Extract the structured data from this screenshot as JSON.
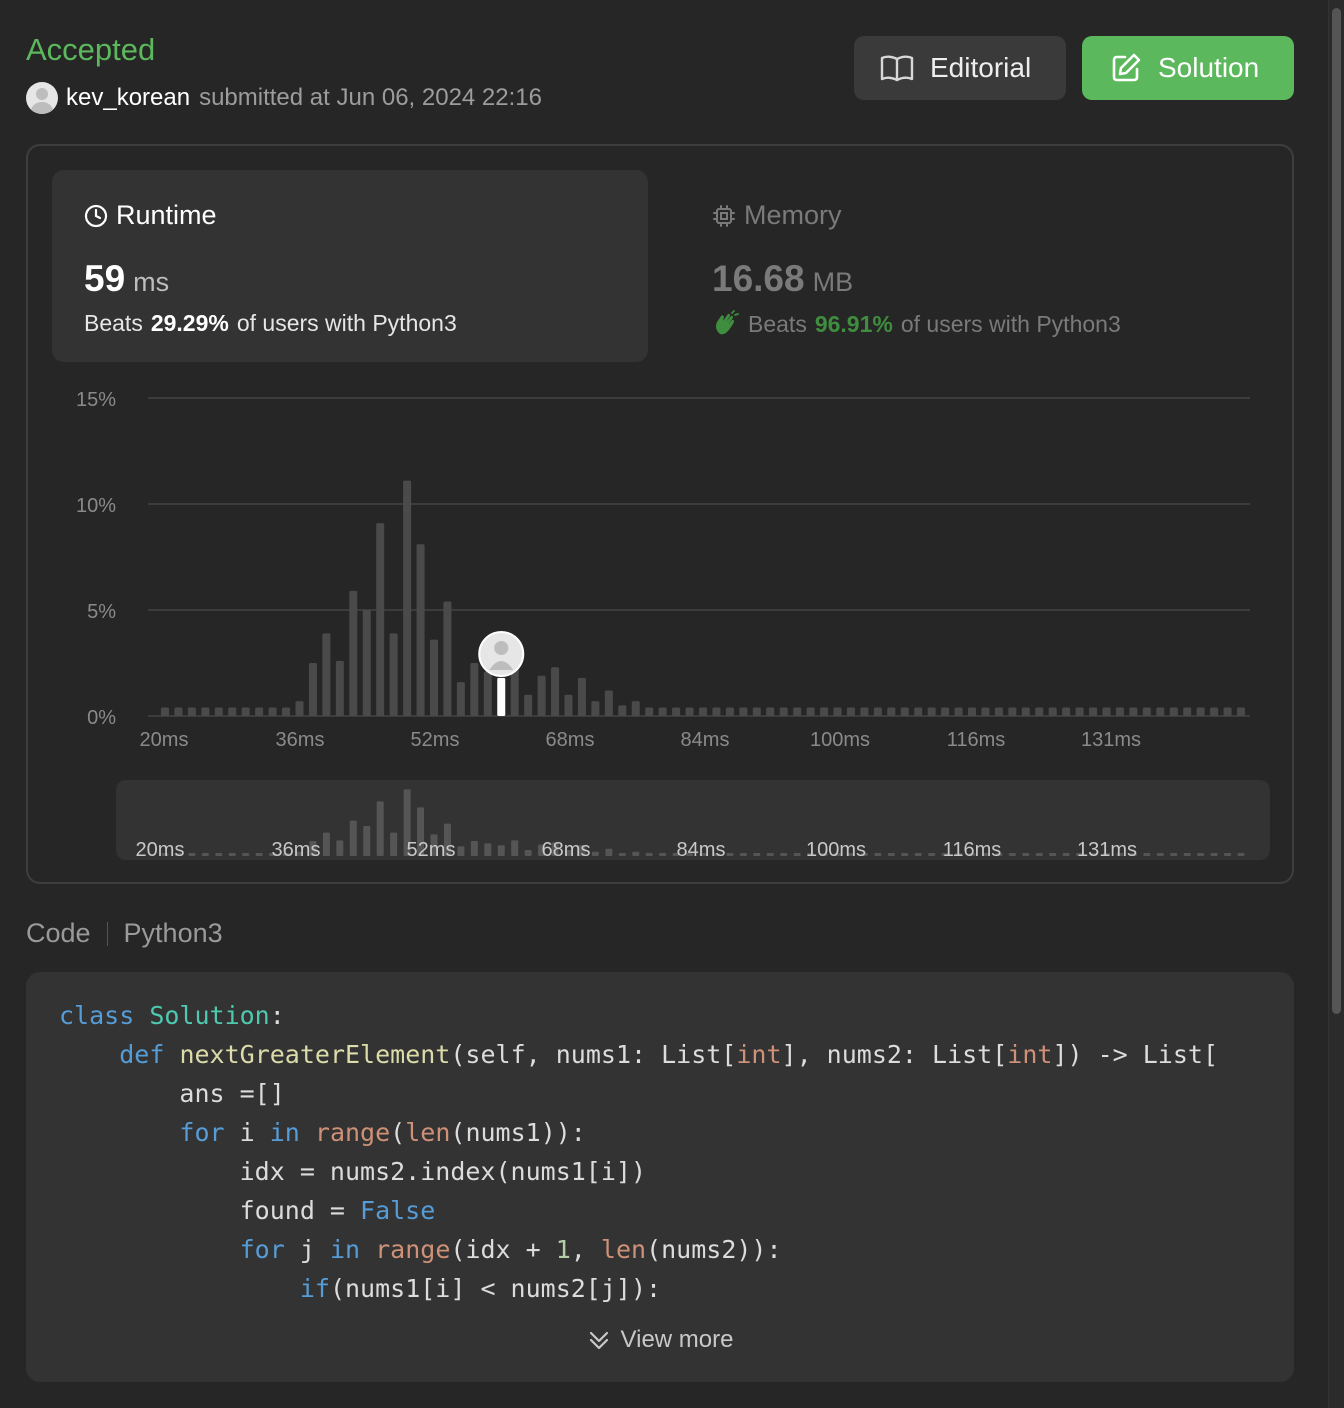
{
  "header": {
    "status": "Accepted",
    "username": "kev_korean",
    "submitted_text": "submitted at Jun 06, 2024 22:16",
    "editorial_label": "Editorial",
    "solution_label": "Solution"
  },
  "runtime": {
    "title": "Runtime",
    "value": "59",
    "unit": "ms",
    "beats_prefix": "Beats",
    "beats_pct": "29.29%",
    "beats_suffix": "of users with Python3"
  },
  "memory": {
    "title": "Memory",
    "value": "16.68",
    "unit": "MB",
    "beats_prefix": "Beats",
    "beats_pct": "96.91%",
    "beats_suffix": "of users with Python3"
  },
  "chart_data": {
    "type": "bar",
    "yticks": [
      "15%",
      "10%",
      "5%",
      "0%"
    ],
    "ylim": [
      0,
      15
    ],
    "xticks": [
      "20ms",
      "36ms",
      "52ms",
      "68ms",
      "84ms",
      "100ms",
      "116ms",
      "131ms"
    ],
    "values": [
      0.4,
      0.4,
      0.4,
      0.4,
      0.4,
      0.4,
      0.4,
      0.4,
      0.4,
      0.4,
      0.7,
      2.5,
      3.9,
      2.6,
      5.9,
      5.0,
      9.1,
      3.9,
      11.1,
      8.1,
      3.6,
      5.4,
      1.6,
      2.5,
      2.1,
      1.8,
      2.6,
      1.0,
      1.9,
      2.3,
      1.0,
      1.8,
      0.7,
      1.2,
      0.5,
      0.7,
      0.4,
      0.4,
      0.4,
      0.4,
      0.4,
      0.4,
      0.4,
      0.4,
      0.4,
      0.4,
      0.4,
      0.4,
      0.4,
      0.4,
      0.4,
      0.4,
      0.4,
      0.4,
      0.4,
      0.4,
      0.4,
      0.4,
      0.4,
      0.4,
      0.4,
      0.4,
      0.4,
      0.4,
      0.4,
      0.4,
      0.4,
      0.4,
      0.4,
      0.4,
      0.4,
      0.4,
      0.4,
      0.4,
      0.4,
      0.4,
      0.4,
      0.4,
      0.4,
      0.4,
      0.4
    ],
    "highlight_index": 25,
    "grid": true
  },
  "code": {
    "label": "Code",
    "language": "Python3",
    "view_more": "View more"
  },
  "colors": {
    "accent_green": "#5cb85c",
    "beats_green_dim": "#3f8d3f",
    "bar": "#4a4a4a",
    "background": "#262626"
  }
}
